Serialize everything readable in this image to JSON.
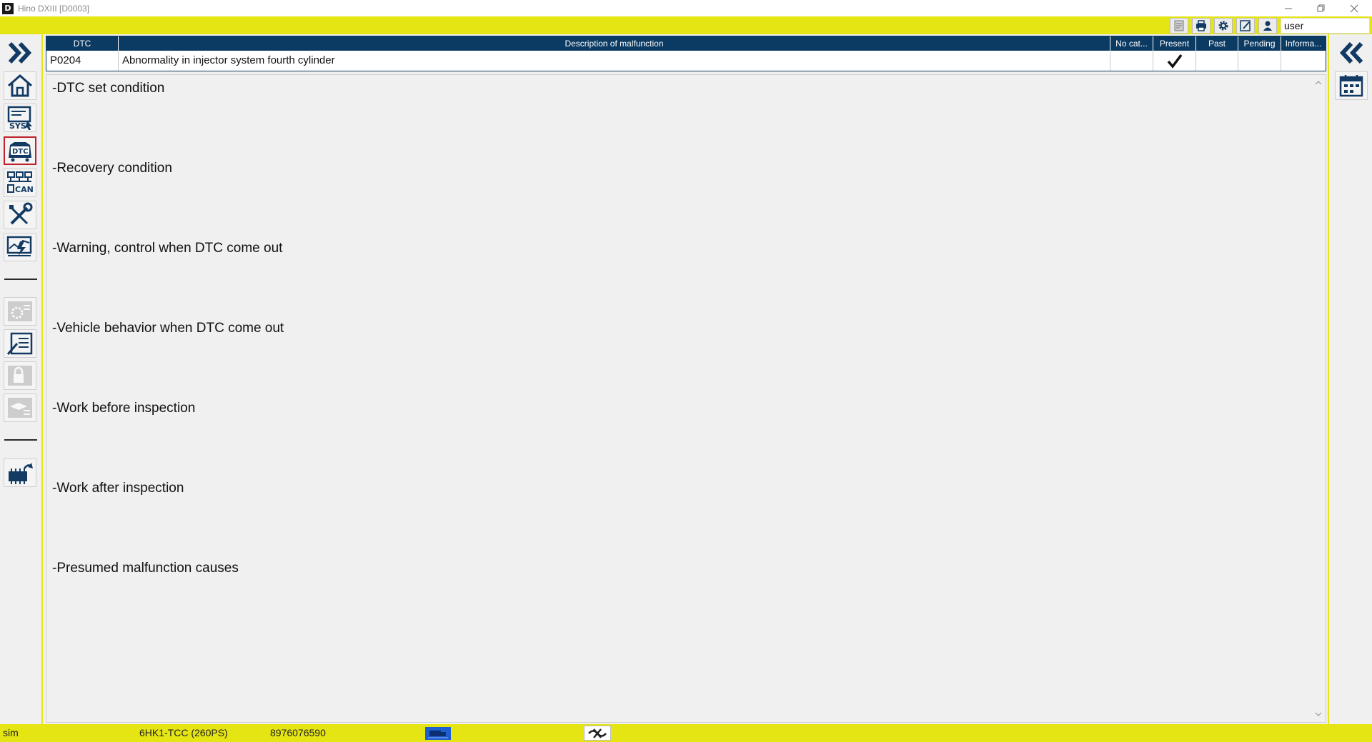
{
  "window": {
    "logo_letter": "D",
    "title": "Hino DXIII [D0003]"
  },
  "toolbar": {
    "user": "user",
    "icons": [
      "report-icon",
      "print-icon",
      "gear-icon",
      "edit-icon",
      "user-icon"
    ]
  },
  "left_sidebar": {
    "items": [
      {
        "name": "expand",
        "icon": "double-chevron-right-icon"
      },
      {
        "name": "home",
        "icon": "home-icon"
      },
      {
        "name": "system-select",
        "icon": "sys-icon",
        "label": "SYS"
      },
      {
        "name": "dtc",
        "icon": "dtc-icon",
        "label": "DTC",
        "active": true
      },
      {
        "name": "can",
        "icon": "can-icon",
        "label": "CAN"
      },
      {
        "name": "tools",
        "icon": "tools-icon"
      },
      {
        "name": "data-monitor",
        "icon": "monitor-icon"
      },
      {
        "name": "settings-disabled",
        "icon": "settings-icon",
        "disabled": true
      },
      {
        "name": "work-support",
        "icon": "checklist-icon"
      },
      {
        "name": "lock-disabled",
        "icon": "lock-icon",
        "disabled": true
      },
      {
        "name": "training-disabled",
        "icon": "training-icon",
        "disabled": true
      },
      {
        "name": "reprogram",
        "icon": "ecu-icon"
      }
    ]
  },
  "right_sidebar": {
    "items": [
      {
        "name": "collapse",
        "icon": "double-chevron-left-icon"
      },
      {
        "name": "calendar",
        "icon": "calendar-icon"
      }
    ]
  },
  "dtc_table": {
    "columns": [
      "DTC",
      "Description of malfunction",
      "No cat...",
      "Present",
      "Past",
      "Pending",
      "Informa..."
    ],
    "rows": [
      {
        "dtc": "P0204",
        "description": "Abnormality in injector system fourth cylinder",
        "no_cat": "",
        "present": true,
        "past": "",
        "pending": "",
        "info": ""
      }
    ]
  },
  "content": {
    "sections": [
      "-DTC set condition",
      "-Recovery condition",
      "-Warning, control when DTC come out",
      "-Vehicle behavior when DTC come out",
      "-Work before inspection",
      "-Work after inspection",
      "-Presumed malfunction causes"
    ]
  },
  "statusbar": {
    "mode": "sim",
    "engine": "6HK1-TCC (260PS)",
    "serial": "8976076590"
  },
  "colors": {
    "accent_yellow": "#e5e514",
    "header_navy": "#0b3a62",
    "active_red": "#c0202a",
    "icon_navy": "#123a63"
  }
}
